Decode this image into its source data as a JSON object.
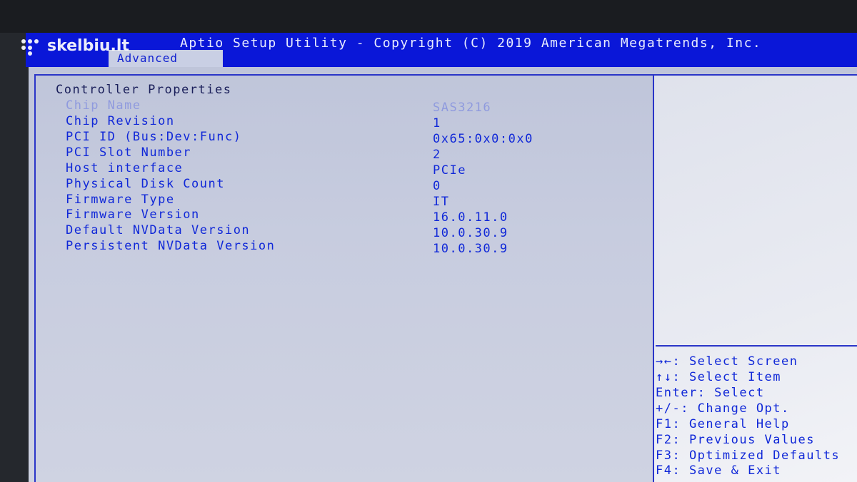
{
  "header": {
    "title": "Aptio Setup Utility - Copyright (C) 2019 American Megatrends, Inc.",
    "active_tab": "Advanced",
    "watermark": "skelbiu.lt"
  },
  "main": {
    "section_title": "Controller Properties",
    "rows": [
      {
        "label": "Chip Name",
        "value": "SAS3216"
      },
      {
        "label": "Chip Revision",
        "value": "1"
      },
      {
        "label": "PCI ID (Bus:Dev:Func)",
        "value": "0x65:0x0:0x0"
      },
      {
        "label": "PCI Slot Number",
        "value": "2"
      },
      {
        "label": "Host interface",
        "value": "PCIe"
      },
      {
        "label": "Physical Disk Count",
        "value": "0"
      },
      {
        "label": "Firmware Type",
        "value": "IT"
      },
      {
        "label": "Firmware Version",
        "value": "16.0.11.0"
      },
      {
        "label": "Default NVData Version",
        "value": "10.0.30.9"
      },
      {
        "label": "Persistent NVData Version",
        "value": "10.0.30.9"
      }
    ]
  },
  "help": {
    "lines": [
      "→←: Select Screen",
      "↑↓: Select Item",
      "Enter: Select",
      "+/-: Change Opt.",
      "F1: General Help",
      "F2: Previous Values",
      "F3: Optimized Defaults",
      "F4: Save & Exit"
    ]
  },
  "colors": {
    "title_bar": "#0a17d8",
    "text_blue": "#1028d8",
    "highlight_text": "#8f9ade",
    "background": "#c7ccdf"
  }
}
